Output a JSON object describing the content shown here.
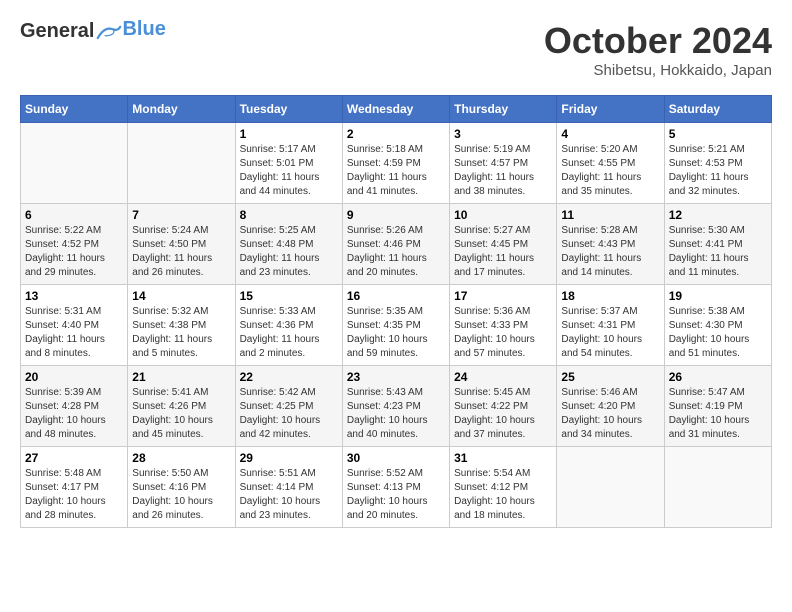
{
  "header": {
    "logo_line1": "General",
    "logo_line2": "Blue",
    "month": "October 2024",
    "location": "Shibetsu, Hokkaido, Japan"
  },
  "weekdays": [
    "Sunday",
    "Monday",
    "Tuesday",
    "Wednesday",
    "Thursday",
    "Friday",
    "Saturday"
  ],
  "weeks": [
    [
      {
        "day": "",
        "sunrise": "",
        "sunset": "",
        "daylight": ""
      },
      {
        "day": "",
        "sunrise": "",
        "sunset": "",
        "daylight": ""
      },
      {
        "day": "1",
        "sunrise": "Sunrise: 5:17 AM",
        "sunset": "Sunset: 5:01 PM",
        "daylight": "Daylight: 11 hours and 44 minutes."
      },
      {
        "day": "2",
        "sunrise": "Sunrise: 5:18 AM",
        "sunset": "Sunset: 4:59 PM",
        "daylight": "Daylight: 11 hours and 41 minutes."
      },
      {
        "day": "3",
        "sunrise": "Sunrise: 5:19 AM",
        "sunset": "Sunset: 4:57 PM",
        "daylight": "Daylight: 11 hours and 38 minutes."
      },
      {
        "day": "4",
        "sunrise": "Sunrise: 5:20 AM",
        "sunset": "Sunset: 4:55 PM",
        "daylight": "Daylight: 11 hours and 35 minutes."
      },
      {
        "day": "5",
        "sunrise": "Sunrise: 5:21 AM",
        "sunset": "Sunset: 4:53 PM",
        "daylight": "Daylight: 11 hours and 32 minutes."
      }
    ],
    [
      {
        "day": "6",
        "sunrise": "Sunrise: 5:22 AM",
        "sunset": "Sunset: 4:52 PM",
        "daylight": "Daylight: 11 hours and 29 minutes."
      },
      {
        "day": "7",
        "sunrise": "Sunrise: 5:24 AM",
        "sunset": "Sunset: 4:50 PM",
        "daylight": "Daylight: 11 hours and 26 minutes."
      },
      {
        "day": "8",
        "sunrise": "Sunrise: 5:25 AM",
        "sunset": "Sunset: 4:48 PM",
        "daylight": "Daylight: 11 hours and 23 minutes."
      },
      {
        "day": "9",
        "sunrise": "Sunrise: 5:26 AM",
        "sunset": "Sunset: 4:46 PM",
        "daylight": "Daylight: 11 hours and 20 minutes."
      },
      {
        "day": "10",
        "sunrise": "Sunrise: 5:27 AM",
        "sunset": "Sunset: 4:45 PM",
        "daylight": "Daylight: 11 hours and 17 minutes."
      },
      {
        "day": "11",
        "sunrise": "Sunrise: 5:28 AM",
        "sunset": "Sunset: 4:43 PM",
        "daylight": "Daylight: 11 hours and 14 minutes."
      },
      {
        "day": "12",
        "sunrise": "Sunrise: 5:30 AM",
        "sunset": "Sunset: 4:41 PM",
        "daylight": "Daylight: 11 hours and 11 minutes."
      }
    ],
    [
      {
        "day": "13",
        "sunrise": "Sunrise: 5:31 AM",
        "sunset": "Sunset: 4:40 PM",
        "daylight": "Daylight: 11 hours and 8 minutes."
      },
      {
        "day": "14",
        "sunrise": "Sunrise: 5:32 AM",
        "sunset": "Sunset: 4:38 PM",
        "daylight": "Daylight: 11 hours and 5 minutes."
      },
      {
        "day": "15",
        "sunrise": "Sunrise: 5:33 AM",
        "sunset": "Sunset: 4:36 PM",
        "daylight": "Daylight: 11 hours and 2 minutes."
      },
      {
        "day": "16",
        "sunrise": "Sunrise: 5:35 AM",
        "sunset": "Sunset: 4:35 PM",
        "daylight": "Daylight: 10 hours and 59 minutes."
      },
      {
        "day": "17",
        "sunrise": "Sunrise: 5:36 AM",
        "sunset": "Sunset: 4:33 PM",
        "daylight": "Daylight: 10 hours and 57 minutes."
      },
      {
        "day": "18",
        "sunrise": "Sunrise: 5:37 AM",
        "sunset": "Sunset: 4:31 PM",
        "daylight": "Daylight: 10 hours and 54 minutes."
      },
      {
        "day": "19",
        "sunrise": "Sunrise: 5:38 AM",
        "sunset": "Sunset: 4:30 PM",
        "daylight": "Daylight: 10 hours and 51 minutes."
      }
    ],
    [
      {
        "day": "20",
        "sunrise": "Sunrise: 5:39 AM",
        "sunset": "Sunset: 4:28 PM",
        "daylight": "Daylight: 10 hours and 48 minutes."
      },
      {
        "day": "21",
        "sunrise": "Sunrise: 5:41 AM",
        "sunset": "Sunset: 4:26 PM",
        "daylight": "Daylight: 10 hours and 45 minutes."
      },
      {
        "day": "22",
        "sunrise": "Sunrise: 5:42 AM",
        "sunset": "Sunset: 4:25 PM",
        "daylight": "Daylight: 10 hours and 42 minutes."
      },
      {
        "day": "23",
        "sunrise": "Sunrise: 5:43 AM",
        "sunset": "Sunset: 4:23 PM",
        "daylight": "Daylight: 10 hours and 40 minutes."
      },
      {
        "day": "24",
        "sunrise": "Sunrise: 5:45 AM",
        "sunset": "Sunset: 4:22 PM",
        "daylight": "Daylight: 10 hours and 37 minutes."
      },
      {
        "day": "25",
        "sunrise": "Sunrise: 5:46 AM",
        "sunset": "Sunset: 4:20 PM",
        "daylight": "Daylight: 10 hours and 34 minutes."
      },
      {
        "day": "26",
        "sunrise": "Sunrise: 5:47 AM",
        "sunset": "Sunset: 4:19 PM",
        "daylight": "Daylight: 10 hours and 31 minutes."
      }
    ],
    [
      {
        "day": "27",
        "sunrise": "Sunrise: 5:48 AM",
        "sunset": "Sunset: 4:17 PM",
        "daylight": "Daylight: 10 hours and 28 minutes."
      },
      {
        "day": "28",
        "sunrise": "Sunrise: 5:50 AM",
        "sunset": "Sunset: 4:16 PM",
        "daylight": "Daylight: 10 hours and 26 minutes."
      },
      {
        "day": "29",
        "sunrise": "Sunrise: 5:51 AM",
        "sunset": "Sunset: 4:14 PM",
        "daylight": "Daylight: 10 hours and 23 minutes."
      },
      {
        "day": "30",
        "sunrise": "Sunrise: 5:52 AM",
        "sunset": "Sunset: 4:13 PM",
        "daylight": "Daylight: 10 hours and 20 minutes."
      },
      {
        "day": "31",
        "sunrise": "Sunrise: 5:54 AM",
        "sunset": "Sunset: 4:12 PM",
        "daylight": "Daylight: 10 hours and 18 minutes."
      },
      {
        "day": "",
        "sunrise": "",
        "sunset": "",
        "daylight": ""
      },
      {
        "day": "",
        "sunrise": "",
        "sunset": "",
        "daylight": ""
      }
    ]
  ]
}
